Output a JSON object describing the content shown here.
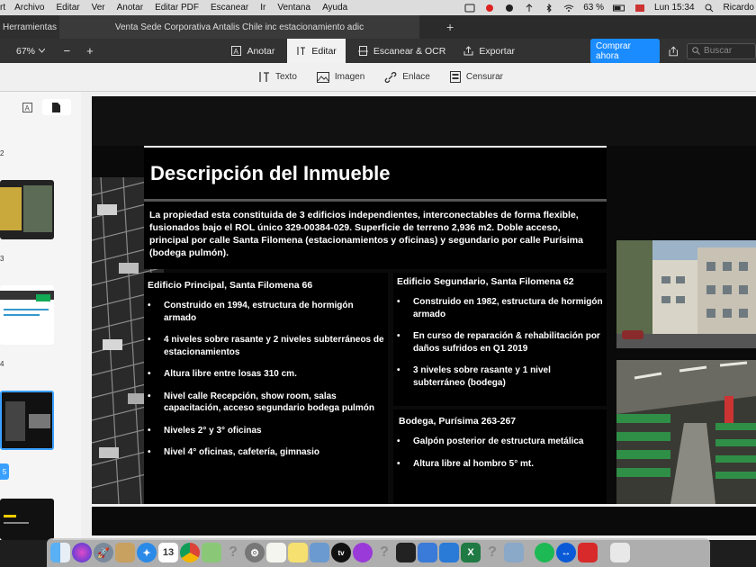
{
  "menubar": {
    "items": [
      "rt",
      "Archivo",
      "Editar",
      "Ver",
      "Anotar",
      "Editar PDF",
      "Escanear",
      "Ir",
      "Ventana",
      "Ayuda"
    ],
    "battery": "63 %",
    "clock": "Lun 15:34",
    "user": "Ricardo"
  },
  "tabbar": {
    "tabs": [
      "Herramientas",
      "Venta Sede Corporativa Antalis Chile inc estacionamiento adic"
    ],
    "add": "+"
  },
  "toolbar": {
    "zoom": "67%",
    "zoom_out": "−",
    "zoom_in": "+",
    "modes": [
      "Anotar",
      "Editar",
      "Escanear & OCR",
      "Exportar"
    ],
    "buy": "Comprar ahora",
    "search_placeholder": "Buscar"
  },
  "subtoolbar": {
    "tools": [
      "Texto",
      "Imagen",
      "Enlace",
      "Censurar"
    ]
  },
  "sidebar": {
    "page_numbers": [
      "2",
      "3",
      "4",
      "5"
    ]
  },
  "slide": {
    "title": "Descripción del Inmueble",
    "intro": "La propiedad esta constituida de 3 edificios independientes, interconectables de forma flexible, fusionados bajo el ROL único 329-00384-029. Superficie de terreno 2,936 m2. Doble acceso, principal por calle Santa Filomena (estacionamientos y oficinas) y segundario por calle Purísima (bodega pulmón).",
    "principal": {
      "heading": "Edificio Principal, Santa Filomena 66",
      "items": [
        "Construido en 1994, estructura de hormigón armado",
        "4 niveles sobre rasante y 2 niveles subterráneos de estacionamientos",
        "Altura libre entre losas 310 cm.",
        "Nivel calle Recepción, show room, salas capacitación, acceso segundario bodega pulmón",
        "Niveles 2° y 3° oficinas",
        "Nivel 4° oficinas, cafetería, gimnasio"
      ]
    },
    "segundario": {
      "heading": "Edificio Segundario, Santa Filomena 62",
      "items": [
        "Construido en 1982, estructura de hormigón armado",
        "En curso de reparación & rehabilitación por daños sufridos en Q1 2019",
        "3 niveles sobre rasante y 1 nivel subterráneo (bodega)"
      ]
    },
    "bodega": {
      "heading": "Bodega, Purísima 263-267",
      "items": [
        "Galpón posterior de estructura metálica",
        "Altura libre al hombro 5° mt."
      ]
    }
  },
  "dock": {
    "calendar_day": "13",
    "apps": [
      "finder-icon",
      "siri-icon",
      "launchpad-icon",
      "notes-icon",
      "safari-icon",
      "calendar-icon",
      "chrome-icon",
      "maps-icon",
      "help-icon",
      "system-preferences-icon",
      "textedit-icon",
      "stickies-icon",
      "preview-icon",
      "appletv-icon",
      "podcasts-icon",
      "help-icon",
      "terminal-icon",
      "scanner-icon",
      "keynote-icon",
      "excel-icon",
      "help-icon",
      "preview-icon",
      "spotify-icon",
      "teamviewer-icon",
      "pdf-expert-icon",
      "trash-icon"
    ]
  }
}
